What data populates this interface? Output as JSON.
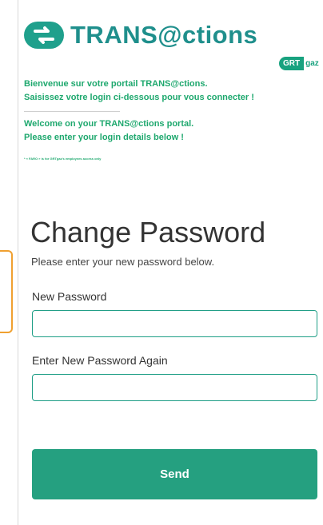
{
  "brand": {
    "logo_text": "TRANS@ctions",
    "partner_logo_pill": "GRT",
    "partner_logo_rest": "gaz",
    "colors": {
      "teal": "#1f8f8c",
      "green": "#1ea86e",
      "button": "#25a080",
      "field_border": "#1f9e86"
    }
  },
  "intro": {
    "fr_line1": "Bienvenue sur votre portail TRANS@ctions.",
    "fr_line2": "Saisissez votre login ci-dessous pour vous connecter !",
    "en_line1": "Welcome on your TRANS@ctions portal.",
    "en_line2": "Please enter your login details below !",
    "footnote": "* « FARO » is for GRTgaz's employees access only"
  },
  "form": {
    "title": "Change Password",
    "subtitle": "Please enter your new password below.",
    "new_password_label": "New Password",
    "new_password_value": "",
    "confirm_password_label": "Enter New Password Again",
    "confirm_password_value": "",
    "submit_label": "Send"
  }
}
